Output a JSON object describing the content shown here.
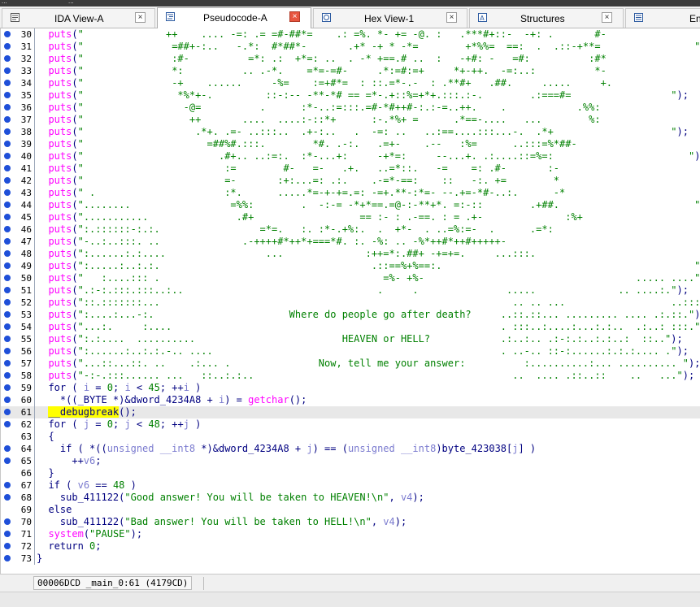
{
  "title_strip": {
    "left": "...",
    "right": "..."
  },
  "tabs": [
    {
      "label": "IDA View-A",
      "icon": "text-view-icon",
      "active": false,
      "close": "×"
    },
    {
      "label": "Pseudocode-A",
      "icon": "pseudocode-icon",
      "active": true,
      "close": "×"
    },
    {
      "label": "Hex View-1",
      "icon": "hex-icon",
      "active": false,
      "close": "×"
    },
    {
      "label": "Structures",
      "icon": "structures-icon",
      "active": false,
      "close": "×"
    },
    {
      "label": "Enu",
      "icon": "enums-icon",
      "active": false
    }
  ],
  "lines": [
    {
      "n": "30",
      "t": "  puts(\"              ++    .... -=: .= =#-##*=    .: =%. *- += -@. :   .***#+::-  -+: .       #-                \");"
    },
    {
      "n": "31",
      "t": "  puts(\"               =##+-:..   -.*:  #*##*-       .+* -+ * -*=        +*%%=  ==:  .  .::-+**=                \");"
    },
    {
      "n": "32",
      "t": "  puts(\"               :#-          =*: .:  +*=: ..  . -* +==.# ..  :   -+#: -   =#:          :#*                \");"
    },
    {
      "n": "33",
      "t": "  puts(\"               *:          .. .-*.    =*=-=#-     .*:=#:=+     *+-++.  -=:..:          *-                \");"
    },
    {
      "n": "34",
      "t": "  puts(\"               -+    ......     -%=    :=+#*=  : ::.=*-.-  : .**#+   .##.     .....     +.               \");"
    },
    {
      "n": "35",
      "t": "  puts(\"                *%*+-.         ::-:-- -**-*# == =*-.+::%=+*+.:::.:-.        .:===#=                 \");"
    },
    {
      "n": "36",
      "t": "  puts(\"                 -@=          .      :*-..:=:::.=#-*#++#-:.:-=..++.    .            .%%:                  \");"
    },
    {
      "n": "37",
      "t": "  puts(\"                  ++       ....  ....:-::*+      :-.*%+ =      .*==-....   ...        %:                   \");"
    },
    {
      "n": "38",
      "t": "  puts(\"                   .*+. .=- ..:::..  .+-:..   .  -=: ..   ..:==....:::...-.  .*+                    \");"
    },
    {
      "n": "39",
      "t": "  puts(\"                     =##%#.:::.        *#. .-:.   .=+-    .--   :%=      ..:::=%*##-                     \");"
    },
    {
      "n": "40",
      "t": "  puts(\"                       .#+.. ..:=:.  :*-...+:     -+*=:     --...+. .:....::=%=:                       \");"
    },
    {
      "n": "41",
      "t": "  puts(\"                        :=        #-   =-   .+.   ..=*::.   -=    =: .#-       :-                         \");"
    },
    {
      "n": "42",
      "t": "  puts(\"                        =-       :+:...=: .:.    .-=*-==:    ::   -:. +=        *                         \");"
    },
    {
      "n": "43",
      "t": "  puts(\" .                      :*.      .....*=-+-+=.=: -=+.**-:*=- --.+=-*#-..:.      -*                         \");"
    },
    {
      "n": "44",
      "t": "  puts(\"........                 =%%:        .  -:-= -*+*==.=@-:-**+*. =:-::        .+##.                       \");"
    },
    {
      "n": "45",
      "t": "  puts(\"...........               .#+                  == :- : .-==. : = .+-              :%+                        \");"
    },
    {
      "n": "46",
      "t": "  puts(\":.::::::-:.:.                 =*=.   :. :*-.+%:.  .  +*-  . ..=%:=-  .      .=*:                          \");"
    },
    {
      "n": "47",
      "t": "  puts(\"-..:..:::. ..              .-++++#*++*+===*#. :. -%: .. -%*++#*++#+++++-                                 \");"
    },
    {
      "n": "48",
      "t": "  puts(\":......:.:....                 ...              :++=*:.##+ -+=+=.     ...:::.                               \");"
    },
    {
      "n": "49",
      "t": "  puts(\":.....:..:.:.                                    .::==%+%==:.                                           \");"
    },
    {
      "n": "50",
      "t": "  puts(\"   :....::: .                                      =%- +%-                                    ..... ....\");"
    },
    {
      "n": "51",
      "t": "  puts(\".:-:.:::.:::..:..                                 .     .               .....              .. ....:.\");"
    },
    {
      "n": "52",
      "t": "  puts(\"::.:::::::...                                                            .. .. ...                  ..::::.\");"
    },
    {
      "n": "53",
      "t": "  puts(\":....:...-:.                       Where do people go after death?     ..::.::... ......... .... .:.::.\");"
    },
    {
      "n": "54",
      "t": "  puts(\"...:.     :....                                                        . :::..:....:...:.:..  .:..: :::.\");"
    },
    {
      "n": "55",
      "t": "  puts(\":.:....  ..........                         HEAVEN or HELL?            .:..:.. .:-:.:..:.:..:  ::..\");"
    },
    {
      "n": "56",
      "t": "  puts(\":......:..:.:.-.. ....                                                 . ..-.. ::-:......:.:.:.... .\");"
    },
    {
      "n": "57",
      "t": "  puts(\"...::...::. ..    .:... .               Now, tell me your answer:          :..........:... .......... \");"
    },
    {
      "n": "58",
      "t": "  puts(\"-:-.:::...... ...   ::..:.:..                                            ..  .... .::..::    ..   ...\");"
    }
  ],
  "code": {
    "l59": {
      "n": "59",
      "for": "for",
      "open": " ( ",
      "i1": "i",
      "eq": " = ",
      "zero": "0",
      "semi1": "; ",
      "i2": "i",
      "lt": " < ",
      "n45": "45",
      "semi2": "; ++",
      "i3": "i",
      "close": " )"
    },
    "l60": {
      "n": "60",
      "a": "    *((_BYTE *)&dword_4234A8 + ",
      "i": "i",
      "b": ") = ",
      "fn": "getchar",
      "c": "();"
    },
    "l61": {
      "n": "61",
      "dbg": "__debugbreak",
      "c": "();"
    },
    "l62": {
      "n": "62",
      "for": "for",
      "open": " ( ",
      "j1": "j",
      "eq": " = ",
      "zero": "0",
      "semi1": "; ",
      "j2": "j",
      "lt": " < ",
      "n48": "48",
      "semi2": "; ++",
      "j3": "j",
      "close": " )"
    },
    "l63": {
      "n": "63",
      "t": "  {"
    },
    "l64": {
      "n": "64",
      "a": "    if ( *((",
      "cast1": "unsigned __int8",
      "b": " *)&dword_4234A8 + ",
      "j": "j",
      "c": ") == (",
      "cast2": "unsigned __int8",
      "d": ")byte_423038[",
      "j2": "j",
      "e": "] )"
    },
    "l65": {
      "n": "65",
      "a": "      ++",
      "v": "v6",
      "c": ";"
    },
    "l66": {
      "n": "66",
      "t": "  }"
    },
    "l67": {
      "n": "67",
      "if": "if",
      "open": " ( ",
      "v": "v6",
      "eq": " == ",
      "n48": "48",
      "close": " )"
    },
    "l68": {
      "n": "68",
      "a": "    sub_411122(",
      "s": "\"Good answer! You will be taken to HEAVEN!\\n\"",
      "b": ", ",
      "v": "v4",
      "c": ");"
    },
    "l69": {
      "n": "69",
      "t": "  else"
    },
    "l70": {
      "n": "70",
      "a": "    sub_411122(",
      "s": "\"Bad answer! You will be taken to HELL!\\n\"",
      "b": ", ",
      "v": "v4",
      "c": ");"
    },
    "l71": {
      "n": "71",
      "fn": "system",
      "a": "(",
      "s": "\"PAUSE\"",
      "c": ");"
    },
    "l72": {
      "n": "72",
      "a": "  return ",
      "zero": "0",
      "c": ";"
    },
    "l73": {
      "n": "73",
      "t": "}"
    }
  },
  "status": {
    "text": "00006DCD  _main_0:61  (4179CD)"
  }
}
